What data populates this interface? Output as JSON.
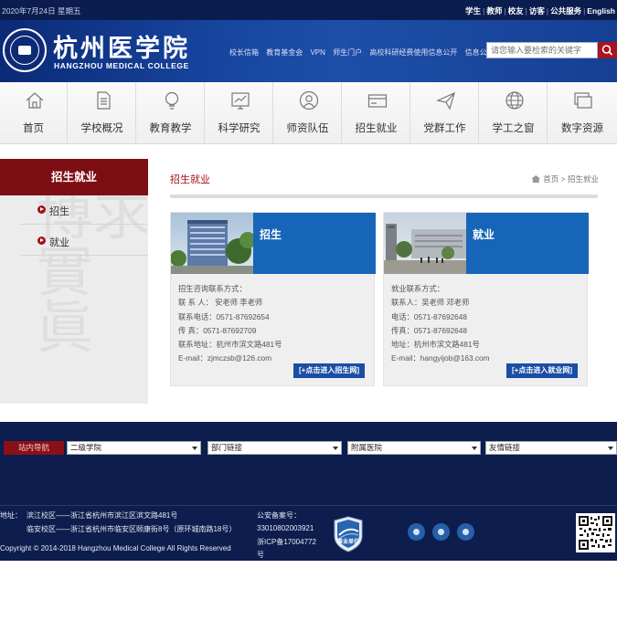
{
  "topbar": {
    "date": "2020年7月24日 星期五",
    "links": [
      "学生",
      "教师",
      "校友",
      "访客",
      "公共服务",
      "English"
    ]
  },
  "header": {
    "logo_cn": "杭州医学院",
    "logo_en": "HANGZHOU MEDICAL COLLEGE",
    "links": [
      "校长信箱",
      "教育基金会",
      "VPN",
      "师生门户",
      "高校科研经费使用信息公开",
      "信息公开"
    ],
    "search_placeholder": "请您输入要检索的关键字"
  },
  "nav": {
    "items": [
      {
        "label": "首页",
        "icon": "home-icon"
      },
      {
        "label": "学校概况",
        "icon": "document-icon"
      },
      {
        "label": "教育教学",
        "icon": "lightbulb-icon"
      },
      {
        "label": "科学研究",
        "icon": "chart-icon"
      },
      {
        "label": "师资队伍",
        "icon": "person-icon"
      },
      {
        "label": "招生就业",
        "icon": "card-icon"
      },
      {
        "label": "党群工作",
        "icon": "paper-plane-icon"
      },
      {
        "label": "学工之窗",
        "icon": "globe-icon"
      },
      {
        "label": "数字资源",
        "icon": "window-icon"
      }
    ]
  },
  "sidebar": {
    "title": "招生就业",
    "items": [
      "招生",
      "就业"
    ]
  },
  "main": {
    "title": "招生就业",
    "breadcrumb_home": "首页",
    "breadcrumb_sep": ">",
    "breadcrumb_current": "招生就业",
    "cards": [
      {
        "title": "招生",
        "lines": [
          "招生咨询联系方式：",
          "联 系 人：  安老师 李老师",
          "联系电话：0571-87692654",
          "传 真：0571-87692709",
          "联系地址：杭州市滨文路481号",
          "E-mail：zjmczsb@126.com"
        ],
        "button": "[+点击进入招生网]"
      },
      {
        "title": "就业",
        "lines": [
          "就业联系方式：",
          "联系人：吴老师 邓老师",
          "电话：0571-87692648",
          "传真：0571-87692648",
          "地址：杭州市滨文路481号",
          "E-mail：hangyijob@163.com"
        ],
        "button": "[+点击进入就业网]"
      }
    ]
  },
  "footer": {
    "station_nav": "站内导航",
    "selects": [
      "二级学院",
      "部门链接",
      "附属医院",
      "友情链接"
    ],
    "address_label": "地址：",
    "address_1": "滨江校区——浙江省杭州市滨江区滨文路481号",
    "address_2": "临安校区——浙江省杭州市临安区颐康街8号（原环城南路18号）",
    "copyright": "Copyright © 2014-2018 Hangzhou Medical College All Rights Reserved",
    "beian_label": "公安备案号：",
    "beian_no": "33010802003921",
    "icp_1": "浙ICP备17004772",
    "icp_2": "号",
    "badge_text": "事业单位"
  }
}
